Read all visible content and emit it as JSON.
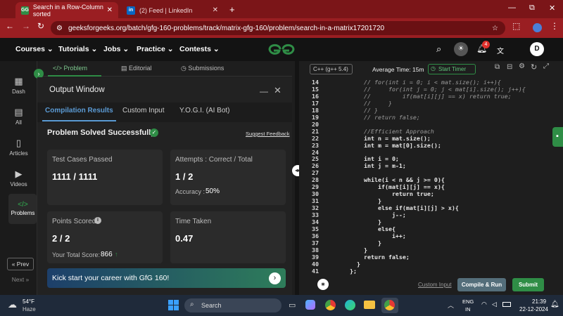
{
  "browser": {
    "tabs": [
      {
        "title": "Search in a Row-Column sorted",
        "icon": "GG",
        "active": true
      },
      {
        "title": "(2) Feed | LinkedIn",
        "icon": "in",
        "active": false
      }
    ],
    "new_tab": "+",
    "url": "geeksforgeeks.org/batch/gfg-160-problems/track/matrix-gfg-160/problem/search-in-a-matrix17201720",
    "win_min": "—",
    "win_max": "⧉",
    "win_close": "✕"
  },
  "site": {
    "menu": [
      "Courses",
      "Tutorials",
      "Jobs",
      "Practice",
      "Contests"
    ],
    "logo": "GfG",
    "notif_count": "4",
    "avatar": "D"
  },
  "rail": [
    {
      "label": "Dash",
      "icon": "▦"
    },
    {
      "label": "All",
      "icon": "▤"
    },
    {
      "label": "Articles",
      "icon": "▯"
    },
    {
      "label": "Videos",
      "icon": "▶"
    },
    {
      "label": "Problems",
      "icon": "</>"
    }
  ],
  "rail_nav": {
    "prev": "« Prev",
    "next": "Next »"
  },
  "problem_tabs": {
    "problem": "</> Problem",
    "editorial": "Editorial",
    "submissions": "Submissions"
  },
  "output": {
    "title": "Output Window",
    "subtabs": [
      "Compilation Results",
      "Custom Input",
      "Y.O.G.I. (AI Bot)"
    ],
    "status": "Problem Solved Successfully",
    "feedback": "Suggest Feedback",
    "tests_label": "Test Cases Passed",
    "tests_value": "1111 / 1111",
    "attempts_label": "Attempts : Correct / Total",
    "attempts_value": "1 / 2",
    "accuracy_label": "Accuracy :",
    "accuracy_value": "50%",
    "points_label": "Points Scored",
    "points_value": "2 / 2",
    "total_label": "Your Total Score:",
    "total_value": "866",
    "time_label": "Time Taken",
    "time_value": "0.47",
    "banner": "Kick start your career with GfG 160!"
  },
  "editor": {
    "language": "C++ (g++ 5.4)",
    "avg_time": "Average Time: 15m",
    "timer": "Start Timer",
    "lines": [
      {
        "n": "14",
        "t": "    // for(int i = 0; i < mat.size(); i++){",
        "c": "cm"
      },
      {
        "n": "15",
        "t": "    //     for(int j = 0; j < mat[i].size(); j++){",
        "c": "cm"
      },
      {
        "n": "16",
        "t": "    //         if(mat[i][j] == x) return true;",
        "c": "cm"
      },
      {
        "n": "17",
        "t": "    //     }",
        "c": "cm"
      },
      {
        "n": "18",
        "t": "    // }",
        "c": "cm"
      },
      {
        "n": "19",
        "t": "    // return false;",
        "c": "cm"
      },
      {
        "n": "20",
        "t": "",
        "c": ""
      },
      {
        "n": "21",
        "t": "    //Efficient Approach",
        "c": "cm"
      },
      {
        "n": "22",
        "t": "    int n = mat.size();",
        "c": ""
      },
      {
        "n": "23",
        "t": "    int m = mat[0].size();",
        "c": ""
      },
      {
        "n": "24",
        "t": "",
        "c": ""
      },
      {
        "n": "25",
        "t": "    int i = 0;",
        "c": ""
      },
      {
        "n": "26",
        "t": "    int j = m-1;",
        "c": ""
      },
      {
        "n": "27",
        "t": "",
        "c": ""
      },
      {
        "n": "28",
        "t": "    while(i < n && j >= 0){",
        "c": ""
      },
      {
        "n": "29",
        "t": "        if(mat[i][j] == x){",
        "c": ""
      },
      {
        "n": "30",
        "t": "            return true;",
        "c": ""
      },
      {
        "n": "31",
        "t": "        }",
        "c": ""
      },
      {
        "n": "32",
        "t": "        else if(mat[i][j] > x){",
        "c": ""
      },
      {
        "n": "33",
        "t": "            j--;",
        "c": ""
      },
      {
        "n": "34",
        "t": "        }",
        "c": ""
      },
      {
        "n": "35",
        "t": "        else{",
        "c": ""
      },
      {
        "n": "36",
        "t": "            i++;",
        "c": ""
      },
      {
        "n": "37",
        "t": "        }",
        "c": ""
      },
      {
        "n": "38",
        "t": "    }",
        "c": ""
      },
      {
        "n": "39",
        "t": "    return false;",
        "c": ""
      },
      {
        "n": "40",
        "t": "  }",
        "c": ""
      },
      {
        "n": "41",
        "t": "};",
        "c": ""
      }
    ],
    "custom_input": "Custom Input",
    "compile": "Compile & Run",
    "submit": "Submit"
  },
  "taskbar": {
    "temp": "54°F",
    "weather": "Haze",
    "search": "Search",
    "lang1": "ENG",
    "lang2": "IN",
    "time": "21:39",
    "date": "22-12-2024"
  },
  "colors": {
    "accent": "#2f8d46",
    "brand_red": "#9a1e22"
  }
}
